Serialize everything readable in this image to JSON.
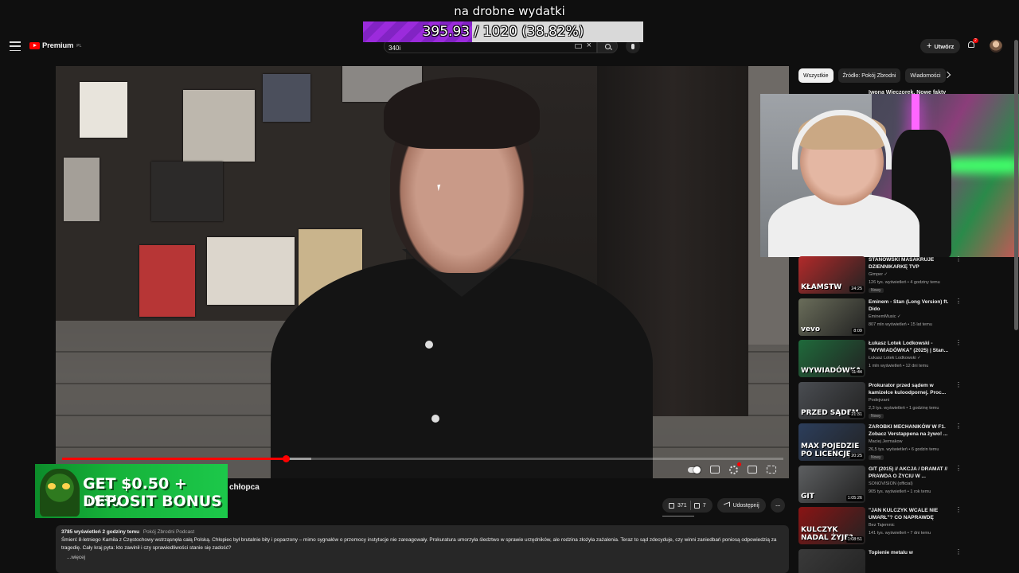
{
  "overlay": {
    "goal_title": "na drobne wydatki",
    "goal_current": "395.93",
    "goal_rest": " / 1020 (38.82%)",
    "goal_fraction": 0.3882
  },
  "header": {
    "logo_text": "Premium",
    "logo_sup": "PL",
    "search_value": "340i",
    "create_label": "Utwórz",
    "notif_count": "2"
  },
  "player": {
    "progress_played_fraction": 0.31,
    "progress_buffered_fraction": 0.345
  },
  "ad": {
    "line1": "GET $0.50 + 10%",
    "line2": "DEPOSIT BONUS"
  },
  "video": {
    "title_tail": "chłopca",
    "likes": "371",
    "dislikes": "7",
    "share_label": "Udostępnij",
    "more_label": "···"
  },
  "description": {
    "views": "3785 wyświetleń",
    "age": "2 godziny temu",
    "tag": "Pokój Zbrodni Podcast",
    "text": "Śmierć 8-letniego Kamila z Częstochowy wstrząsnęła całą Polską. Chłopiec był brutalnie bity i poparzony – mimo sygnałów o przemocy instytucje nie zareagowały. Prokuratura umorzyła śledztwo w sprawie urzędników, ale rodzina złożyła zażalenia. Teraz to sąd zdecyduje, czy winni zaniedbań poniosą odpowiedzią za tragedię. Cały kraj pyta: kto zawinił i czy sprawiedliwości stanie się zadość?",
    "more": "...więcej"
  },
  "chips": [
    "Wszystkie",
    "Źródło: Pokój Zbrodni",
    "Wiadomości"
  ],
  "hidden_row_title": "Iwona Wieczorek. Nowe fakty",
  "recommendations": [
    {
      "title": "STANOWSKI MASAKRUJE DZIENNIKARKĘ TVP",
      "channel": "Gimper ✓",
      "stats": "126 tys. wyświetleń • 4 godziny temu",
      "badge": "Nowy",
      "duration": "24:25",
      "thumb_text": "KŁAMSTW",
      "color": "#b22a2a"
    },
    {
      "title": "Eminem - Stan (Long Version) ft. Dido",
      "channel": "EminemMusic ✓",
      "stats": "807 mln wyświetleń • 15 lat temu",
      "badge": "",
      "duration": "8:09",
      "thumb_text": "vevo",
      "color": "#6a6d5a"
    },
    {
      "title": "Łukasz Lotek Lodkowski - \"WYWIADÓWKA\" (2025) | Stan...",
      "channel": "Łukasz Lotek Lodkowski ✓",
      "stats": "1 mln wyświetleń • 12 dni temu",
      "badge": "",
      "duration": "11:44",
      "thumb_text": "WYWIADÓWKA",
      "color": "#1f6a3b"
    },
    {
      "title": "Prokurator przed sądem w kamizelce kuloodpornej. Proc...",
      "channel": "Podejrzani",
      "stats": "2,3 tys. wyświetleń • 1 godzinę temu",
      "badge": "Nowy",
      "duration": "21:31",
      "thumb_text": "PRZED SĄDEM",
      "color": "#4a4d52"
    },
    {
      "title": "ZAROBKI MECHANIKÓW W F1. Zobacz Verstappena na żywo! ...",
      "channel": "Maciej Jermakow",
      "stats": "26,5 tys. wyświetleń • 6 godzin temu",
      "badge": "Nowy",
      "duration": "20:25",
      "thumb_text": "MAX POJEDZIE PO LICENCJĘ",
      "color": "#2c3e5c"
    },
    {
      "title": "GIT (2015) // AKCJA / DRAMAT // PRAWDA O ŻYCIU W ...",
      "channel": "SONOVISION (official)",
      "stats": "905 tys. wyświetleń • 1 rok temu",
      "badge": "",
      "duration": "1:05:26",
      "thumb_text": "GIT",
      "color": "#5d5f61"
    },
    {
      "title": "\"JAN KULCZYK WCALE NIE UMARŁ\"? CO NAPRAWDĘ STAŁ...",
      "channel": "Bez Tajemnic",
      "stats": "141 tys. wyświetleń • 7 dni temu",
      "badge": "",
      "duration": "1:08:51",
      "thumb_text": "KULCZYK NADAL ŻYJE?",
      "color": "#8a1414"
    },
    {
      "title": "Topienie metalu w",
      "channel": "",
      "stats": "",
      "badge": "",
      "duration": "",
      "thumb_text": "",
      "color": "#3a3a3a"
    }
  ]
}
